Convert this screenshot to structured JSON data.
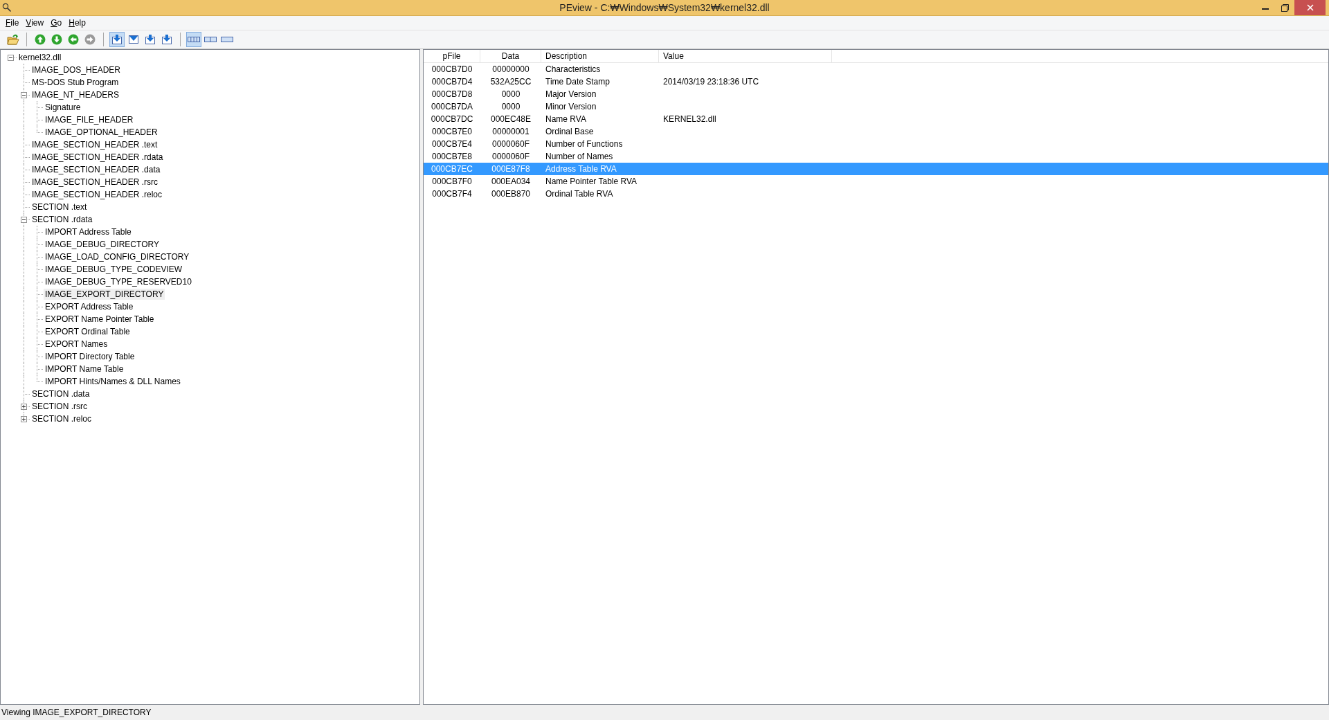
{
  "window": {
    "title": "PEview - C:₩Windows₩System32₩kernel32.dll"
  },
  "menu": [
    {
      "label": "File"
    },
    {
      "label": "View"
    },
    {
      "label": "Go"
    },
    {
      "label": "Help"
    }
  ],
  "toolbar": [
    {
      "buttons": [
        {
          "kind": "open"
        }
      ]
    },
    {
      "buttons": [
        {
          "kind": "up",
          "disabled": false
        },
        {
          "kind": "down",
          "disabled": false
        },
        {
          "kind": "back",
          "disabled": false
        },
        {
          "kind": "forward",
          "disabled": true
        }
      ]
    },
    {
      "buttons": [
        {
          "kind": "view-a",
          "selected": true
        },
        {
          "kind": "view-b",
          "selected": false
        },
        {
          "kind": "view-c",
          "selected": false
        },
        {
          "kind": "view-d",
          "selected": false
        }
      ]
    },
    {
      "buttons": [
        {
          "kind": "layout-a",
          "selected": true
        },
        {
          "kind": "layout-b",
          "selected": false
        },
        {
          "kind": "layout-c",
          "selected": false
        }
      ]
    }
  ],
  "tree": [
    {
      "label": "kernel32.dll",
      "selected": false,
      "expanded": true,
      "children": [
        {
          "label": "IMAGE_DOS_HEADER",
          "selected": false
        },
        {
          "label": "MS-DOS Stub Program",
          "selected": false
        },
        {
          "label": "IMAGE_NT_HEADERS",
          "selected": false,
          "expanded": true,
          "children": [
            {
              "label": "Signature",
              "selected": false
            },
            {
              "label": "IMAGE_FILE_HEADER",
              "selected": false
            },
            {
              "label": "IMAGE_OPTIONAL_HEADER",
              "selected": false
            }
          ]
        },
        {
          "label": "IMAGE_SECTION_HEADER .text",
          "selected": false
        },
        {
          "label": "IMAGE_SECTION_HEADER .rdata",
          "selected": false
        },
        {
          "label": "IMAGE_SECTION_HEADER .data",
          "selected": false
        },
        {
          "label": "IMAGE_SECTION_HEADER .rsrc",
          "selected": false
        },
        {
          "label": "IMAGE_SECTION_HEADER .reloc",
          "selected": false
        },
        {
          "label": "SECTION .text",
          "selected": false
        },
        {
          "label": "SECTION .rdata",
          "selected": false,
          "expanded": true,
          "children": [
            {
              "label": "IMPORT Address Table",
              "selected": false
            },
            {
              "label": "IMAGE_DEBUG_DIRECTORY",
              "selected": false
            },
            {
              "label": "IMAGE_LOAD_CONFIG_DIRECTORY",
              "selected": false
            },
            {
              "label": "IMAGE_DEBUG_TYPE_CODEVIEW",
              "selected": false
            },
            {
              "label": "IMAGE_DEBUG_TYPE_RESERVED10",
              "selected": false
            },
            {
              "label": "IMAGE_EXPORT_DIRECTORY",
              "selected": true
            },
            {
              "label": "EXPORT Address Table",
              "selected": false
            },
            {
              "label": "EXPORT Name Pointer Table",
              "selected": false
            },
            {
              "label": "EXPORT Ordinal Table",
              "selected": false
            },
            {
              "label": "EXPORT Names",
              "selected": false
            },
            {
              "label": "IMPORT Directory Table",
              "selected": false
            },
            {
              "label": "IMPORT Name Table",
              "selected": false
            },
            {
              "label": "IMPORT Hints/Names & DLL Names",
              "selected": false
            }
          ]
        },
        {
          "label": "SECTION .data",
          "selected": false
        },
        {
          "label": "SECTION .rsrc",
          "selected": false,
          "expanded": false
        },
        {
          "label": "SECTION .reloc",
          "selected": false,
          "expanded": false
        }
      ]
    }
  ],
  "table": {
    "columns": [
      "pFile",
      "Data",
      "Description",
      "Value"
    ],
    "rows": [
      {
        "pfile": "000CB7D0",
        "data": "00000000",
        "description": "Characteristics",
        "selected": false
      },
      {
        "pfile": "000CB7D4",
        "data": "532A25CC",
        "description": "Time Date Stamp",
        "value": "2014/03/19  23:18:36 UTC",
        "selected": false
      },
      {
        "pfile": "000CB7D8",
        "data": "0000",
        "description": "Major Version",
        "selected": false
      },
      {
        "pfile": "000CB7DA",
        "data": "0000",
        "description": "Minor Version",
        "selected": false
      },
      {
        "pfile": "000CB7DC",
        "data": "000EC48E",
        "description": "Name RVA",
        "value": "KERNEL32.dll",
        "selected": false
      },
      {
        "pfile": "000CB7E0",
        "data": "00000001",
        "description": "Ordinal Base",
        "selected": false
      },
      {
        "pfile": "000CB7E4",
        "data": "0000060F",
        "description": "Number of Functions",
        "selected": false
      },
      {
        "pfile": "000CB7E8",
        "data": "0000060F",
        "description": "Number of Names",
        "selected": false
      },
      {
        "pfile": "000CB7EC",
        "data": "000E87F8",
        "description": "Address Table RVA",
        "selected": true
      },
      {
        "pfile": "000CB7F0",
        "data": "000EA034",
        "description": "Name Pointer Table RVA",
        "selected": false
      },
      {
        "pfile": "000CB7F4",
        "data": "000EB870",
        "description": "Ordinal Table RVA",
        "selected": false
      }
    ]
  },
  "status_bar": {
    "text": "Viewing IMAGE_EXPORT_DIRECTORY"
  }
}
